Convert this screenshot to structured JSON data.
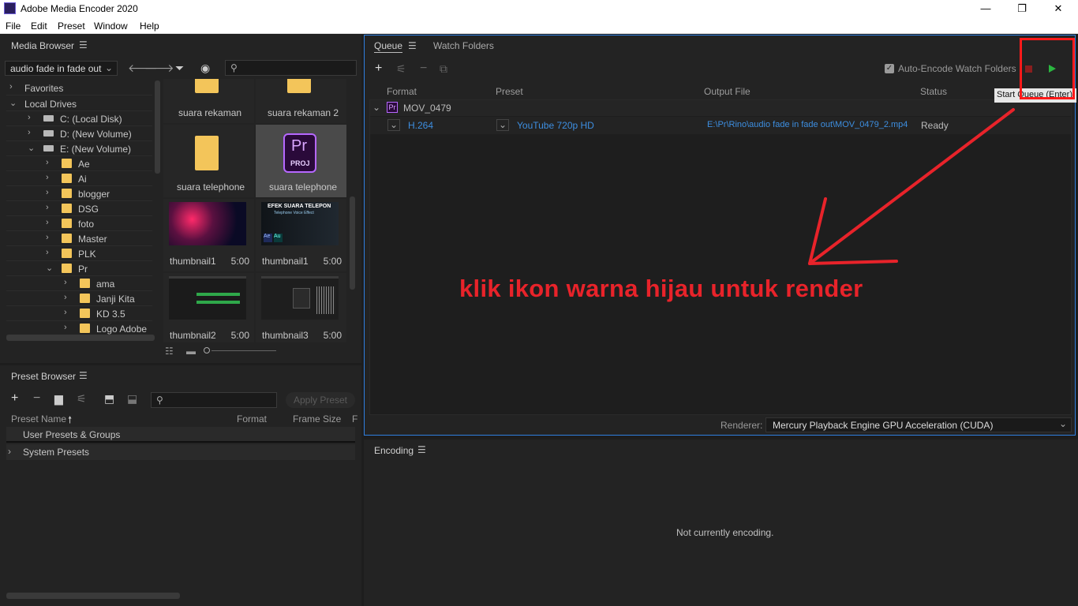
{
  "window": {
    "title": "Adobe Media Encoder 2020",
    "minimize": "—",
    "restore": "❐",
    "close": "✕"
  },
  "menu": [
    "File",
    "Edit",
    "Preset",
    "Window",
    "Help"
  ],
  "media_browser": {
    "title": "Media Browser",
    "location": "audio fade in fade out",
    "tree": [
      {
        "label": "Favorites",
        "level": 0,
        "type": "section"
      },
      {
        "label": "Local Drives",
        "level": 0,
        "type": "section"
      },
      {
        "label": "C: (Local Disk)",
        "level": 1,
        "type": "drive"
      },
      {
        "label": "D: (New Volume)",
        "level": 1,
        "type": "drive"
      },
      {
        "label": "E: (New Volume)",
        "level": 1,
        "type": "drive"
      },
      {
        "label": "Ae",
        "level": 2,
        "type": "folder"
      },
      {
        "label": "Ai",
        "level": 2,
        "type": "folder"
      },
      {
        "label": "blogger",
        "level": 2,
        "type": "folder"
      },
      {
        "label": "DSG",
        "level": 2,
        "type": "folder"
      },
      {
        "label": "foto",
        "level": 2,
        "type": "folder"
      },
      {
        "label": "Master",
        "level": 2,
        "type": "folder"
      },
      {
        "label": "PLK",
        "level": 2,
        "type": "folder"
      },
      {
        "label": "Pr",
        "level": 2,
        "type": "folder"
      },
      {
        "label": "ama",
        "level": 3,
        "type": "folder"
      },
      {
        "label": "Janji Kita",
        "level": 3,
        "type": "folder"
      },
      {
        "label": "KD 3.5",
        "level": 3,
        "type": "folder"
      },
      {
        "label": "Logo Adobe",
        "level": 3,
        "type": "folder"
      }
    ],
    "items": [
      {
        "name": "suara rekaman",
        "kind": "folder",
        "duration": ""
      },
      {
        "name": "suara rekaman 2",
        "kind": "folder",
        "duration": ""
      },
      {
        "name": "suara telephone",
        "kind": "folder",
        "duration": ""
      },
      {
        "name": "suara telephone",
        "kind": "project",
        "duration": ""
      },
      {
        "name": "thumbnail1",
        "kind": "video",
        "duration": "5:00"
      },
      {
        "name": "thumbnail1",
        "kind": "video",
        "duration": "5:00"
      },
      {
        "name": "thumbnail2",
        "kind": "video",
        "duration": "5:00"
      },
      {
        "name": "thumbnail3",
        "kind": "video",
        "duration": "5:00"
      }
    ],
    "proj_icon": {
      "big": "Pr",
      "small": "PROJ"
    },
    "thumb_text": {
      "title": "EFEK SUARA TELEPON",
      "subtitle": "Telephone Voice Effect",
      "badge1": "Ae",
      "badge2": "Au"
    }
  },
  "preset_browser": {
    "title": "Preset Browser",
    "apply_label": "Apply Preset",
    "columns": [
      "Preset Name",
      "Format",
      "Frame Size",
      "F"
    ],
    "groups": [
      "User Presets & Groups",
      "System Presets"
    ]
  },
  "queue": {
    "tabs": [
      "Queue",
      "Watch Folders"
    ],
    "auto_encode_label": "Auto-Encode Watch Folders",
    "auto_encode_checked": true,
    "columns": [
      "Format",
      "Preset",
      "Output File",
      "Status"
    ],
    "source": {
      "name": "MOV_0479",
      "badge": "Pr"
    },
    "output": {
      "format": "H.264",
      "preset": "YouTube 720p HD",
      "file": "E:\\Pr\\Rino\\audio fade in fade out\\MOV_0479_2.mp4",
      "status": "Ready"
    },
    "renderer_label": "Renderer:",
    "renderer_value": "Mercury Playback Engine GPU Acceleration (CUDA)",
    "tooltip": "Start Queue (Enter)"
  },
  "encoding": {
    "title": "Encoding",
    "status": "Not currently encoding."
  },
  "annotation": {
    "text": "klik ikon warna hijau untuk render"
  },
  "colors": {
    "accent": "#2f7fe0",
    "play": "#2bb640",
    "stop": "#8a1e1e",
    "annotation": "#e8232a"
  }
}
